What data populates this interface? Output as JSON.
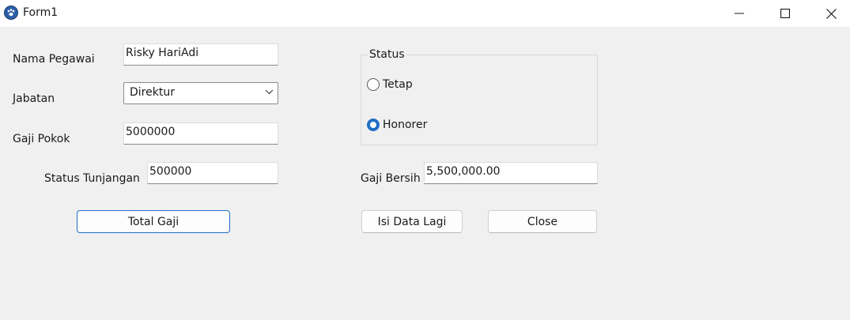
{
  "window": {
    "title": "Form1",
    "icon": "paw-icon",
    "controls": [
      "minimize-icon",
      "maximize-icon",
      "close-icon"
    ]
  },
  "form": {
    "nama_pegawai": {
      "label": "Nama Pegawai",
      "value": "Risky HariAdi"
    },
    "jabatan": {
      "label": "Jabatan",
      "value": "Direktur"
    },
    "gaji_pokok": {
      "label": "Gaji Pokok",
      "value": "5000000"
    },
    "status_tunjangan": {
      "label": "Status Tunjangan",
      "value": "500000"
    },
    "status": {
      "title": "Status",
      "options": [
        {
          "label": "Tetap",
          "selected": false
        },
        {
          "label": "Honorer",
          "selected": true
        }
      ]
    },
    "gaji_bersih": {
      "label": "Gaji Bersih",
      "value": "5,500,000.00"
    }
  },
  "buttons": {
    "total_gaji": "Total Gaji",
    "isi_data_lagi": "Isi Data Lagi",
    "close": "Close"
  },
  "colors": {
    "window_bg": "#f0f0f0",
    "titlebar_bg": "#ffffff",
    "accent": "#1f6fc5"
  }
}
